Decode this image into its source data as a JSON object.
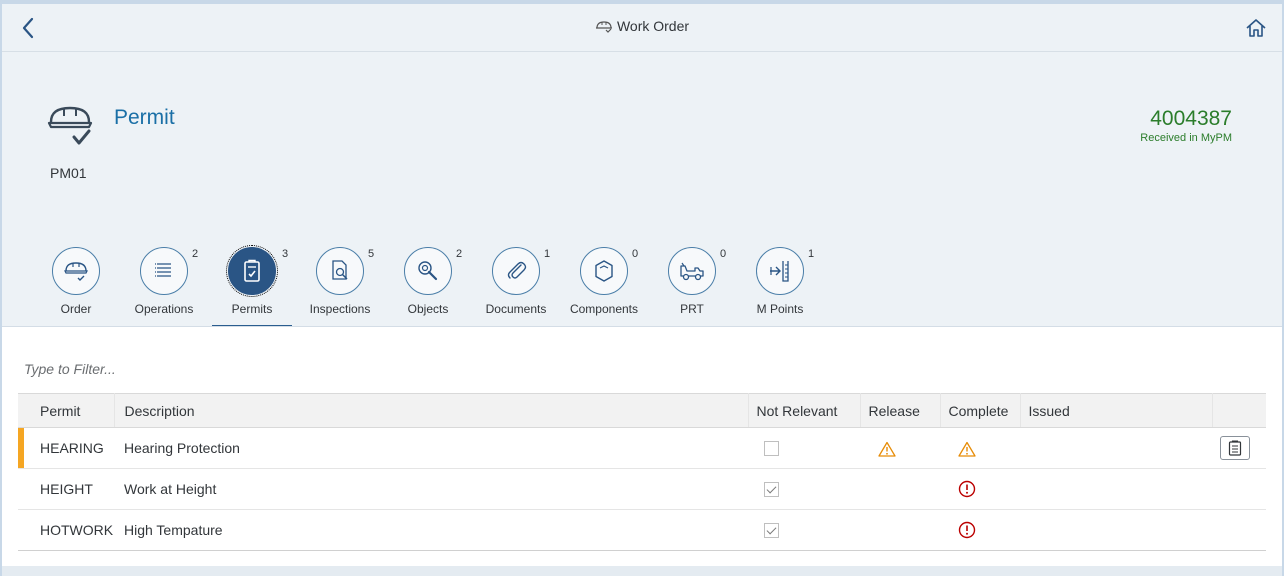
{
  "shell": {
    "title": "Work Order",
    "back_icon": "chevron-left-icon",
    "home_icon": "home-icon",
    "title_icon": "hard-hat-icon"
  },
  "header": {
    "title": "Permit",
    "code": "PM01",
    "number": "4004387",
    "status": "Received in MyPM",
    "icon": "hard-hat-check-icon",
    "colors": {
      "title": "#1a6fa6",
      "number": "#2b7d2b"
    }
  },
  "tabs": [
    {
      "label": "Order",
      "count": "",
      "icon": "hard-hat-check-icon"
    },
    {
      "label": "Operations",
      "count": "2",
      "icon": "list-icon"
    },
    {
      "label": "Permits",
      "count": "3",
      "icon": "clipboard-check-icon",
      "selected": true
    },
    {
      "label": "Inspections",
      "count": "5",
      "icon": "document-search-icon"
    },
    {
      "label": "Objects",
      "count": "2",
      "icon": "wrench-icon"
    },
    {
      "label": "Documents",
      "count": "1",
      "icon": "paperclip-icon"
    },
    {
      "label": "Components",
      "count": "0",
      "icon": "package-icon"
    },
    {
      "label": "PRT",
      "count": "0",
      "icon": "forklift-icon"
    },
    {
      "label": "M Points",
      "count": "1",
      "icon": "measuring-point-icon"
    }
  ],
  "filter": {
    "placeholder": "Type to Filter..."
  },
  "table": {
    "columns": [
      "Permit",
      "Description",
      "Not Relevant",
      "Release",
      "Complete",
      "Issued"
    ],
    "rows": [
      {
        "permit": "HEARING",
        "description": "Hearing Protection",
        "not_relevant": false,
        "release": "warning",
        "complete": "warning",
        "issued": "",
        "highlighted": true,
        "action_icon": "clipboard-icon"
      },
      {
        "permit": "HEIGHT",
        "description": "Work at Height",
        "not_relevant": true,
        "release": "",
        "complete": "error",
        "issued": "",
        "highlighted": false
      },
      {
        "permit": "HOTWORK",
        "description": "High Tempature",
        "not_relevant": true,
        "release": "",
        "complete": "error",
        "issued": "",
        "highlighted": false
      }
    ]
  },
  "colors": {
    "warning": "#e78c07",
    "error": "#bb0000",
    "highlight": "#f5a623",
    "accent": "#2a5585"
  }
}
